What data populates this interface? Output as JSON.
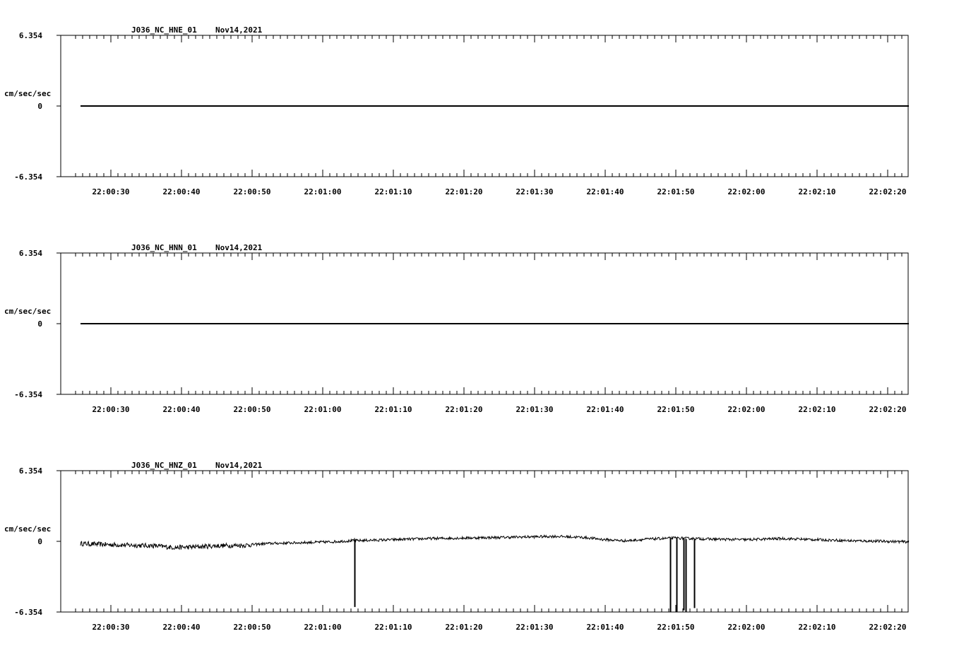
{
  "chart_data": [
    {
      "type": "line",
      "title": "J036_NC_HNE_01",
      "date": "Nov14,2021",
      "ylabel": "cm/sec/sec",
      "ylim": [
        -6.354,
        6.354
      ],
      "ytick_labels": [
        "6.354",
        "0",
        "-6.354"
      ],
      "xtick_labels": [
        "22:00:30",
        "22:00:40",
        "22:00:50",
        "22:01:00",
        "22:01:10",
        "22:01:20",
        "22:01:30",
        "22:01:40",
        "22:01:50",
        "22:02:00",
        "22:02:10",
        "22:02:20"
      ],
      "x_start_seconds_rel": -5.7,
      "x_end_seconds_rel": 113,
      "trace_start_seconds_rel": -4.3,
      "series": [
        {
          "values": [
            [
              -4.3,
              0
            ],
            [
              113,
              0
            ]
          ]
        }
      ]
    },
    {
      "type": "line",
      "title": "J036_NC_HNN_01",
      "date": "Nov14,2021",
      "ylabel": "cm/sec/sec",
      "ylim": [
        -6.354,
        6.354
      ],
      "ytick_labels": [
        "6.354",
        "0",
        "-6.354"
      ],
      "xtick_labels": [
        "22:00:30",
        "22:00:40",
        "22:00:50",
        "22:01:00",
        "22:01:10",
        "22:01:20",
        "22:01:30",
        "22:01:40",
        "22:01:50",
        "22:02:00",
        "22:02:10",
        "22:02:20"
      ],
      "x_start_seconds_rel": -5.7,
      "x_end_seconds_rel": 113,
      "trace_start_seconds_rel": -4.3,
      "series": [
        {
          "values": [
            [
              -4.3,
              0
            ],
            [
              113,
              0
            ]
          ]
        }
      ]
    },
    {
      "type": "line",
      "title": "J036_NC_HNZ_01",
      "date": "Nov14,2021",
      "ylabel": "cm/sec/sec",
      "ylim": [
        -6.354,
        6.354
      ],
      "ytick_labels": [
        "6.354",
        "0",
        "-6.354"
      ],
      "xtick_labels": [
        "22:00:30",
        "22:00:40",
        "22:00:50",
        "22:01:00",
        "22:01:10",
        "22:01:20",
        "22:01:30",
        "22:01:40",
        "22:01:50",
        "22:02:00",
        "22:02:10",
        "22:02:20"
      ],
      "x_start_seconds_rel": -5.7,
      "x_end_seconds_rel": 113,
      "trace_start_seconds_rel": -4.3,
      "series": [
        {
          "values": [
            [
              -4.3,
              -0.2
            ],
            [
              0,
              -0.3
            ],
            [
              3,
              -0.35
            ],
            [
              6,
              -0.4
            ],
            [
              9,
              -0.55
            ],
            [
              12,
              -0.5
            ],
            [
              15,
              -0.4
            ],
            [
              19,
              -0.35
            ],
            [
              22,
              -0.2
            ],
            [
              25,
              -0.15
            ],
            [
              28,
              -0.1
            ],
            [
              31,
              -0.05
            ],
            [
              34,
              0.05
            ],
            [
              37,
              0.1
            ],
            [
              40,
              0.15
            ],
            [
              45,
              0.25
            ],
            [
              50,
              0.3
            ],
            [
              55,
              0.35
            ],
            [
              59,
              0.4
            ],
            [
              63,
              0.45
            ],
            [
              67,
              0.35
            ],
            [
              70,
              0.15
            ],
            [
              73,
              0.05
            ],
            [
              76,
              0.2
            ],
            [
              80,
              0.3
            ],
            [
              85,
              0.2
            ],
            [
              90,
              0.15
            ],
            [
              95,
              0.25
            ],
            [
              100,
              0.15
            ],
            [
              105,
              0.05
            ],
            [
              110,
              0.0
            ],
            [
              113,
              -0.05
            ]
          ],
          "noise": 0.12,
          "spikes": [
            {
              "x": 34.5,
              "y": -5.9
            },
            {
              "x": 79.2,
              "y": -6.35
            },
            {
              "x": 80.1,
              "y": -6.35
            },
            {
              "x": 81.1,
              "y": -6.2
            },
            {
              "x": 81.4,
              "y": -6.35
            },
            {
              "x": 82.6,
              "y": -6.0
            }
          ]
        }
      ]
    }
  ]
}
